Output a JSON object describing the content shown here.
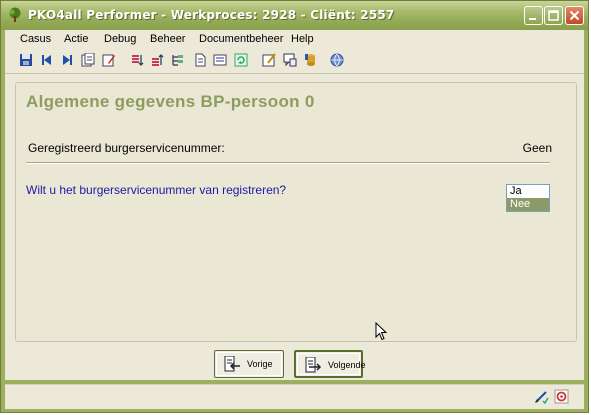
{
  "window": {
    "title": "PKO4all Performer - Werkproces: 2928 - Cliënt: 2557"
  },
  "menu": [
    "Casus",
    "Actie",
    "Debug",
    "Beheer",
    "Documentbeheer",
    "Help"
  ],
  "toolbar_icons": [
    "save-icon",
    "first-record-icon",
    "previous-icon",
    "next-icon",
    "copy-icon",
    "edit-icon",
    "sort-ascending-icon",
    "sort-descending-icon",
    "tree-icon",
    "document-icon",
    "list-icon",
    "refresh-icon",
    "edit-document-icon",
    "comment-icon",
    "database-icon",
    "globe-help-icon"
  ],
  "page": {
    "heading": "Algemene gegevens BP-persoon 0",
    "field_label": "Geregistreerd burgerservicenummer:",
    "field_value": "Geen",
    "question": "Wilt u het burgerservicenummer van registreren?",
    "options": [
      "Ja",
      "Nee"
    ],
    "selected_option": "Nee"
  },
  "nav": {
    "previous_label": "Vorige",
    "next_label": "Volgende"
  },
  "colors": {
    "title_bar": "#9db060",
    "heading": "#8c9e5e",
    "question": "#1a1aa8",
    "selection": "#8c9a68"
  }
}
